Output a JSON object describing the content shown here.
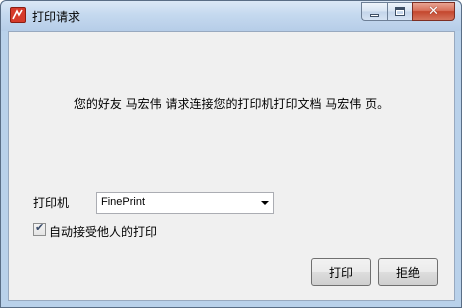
{
  "window": {
    "title": "打印请求",
    "icon": "print-app-icon",
    "controls": {
      "minimize": "minimize-icon",
      "maximize": "maximize-icon",
      "close": "close-icon"
    }
  },
  "message": "您的好友 马宏伟 请求连接您的打印机打印文档 马宏伟 页。",
  "printer": {
    "label": "打印机",
    "selected": "FinePrint"
  },
  "auto_accept": {
    "label": "自动接受他人的打印",
    "checked": true
  },
  "buttons": {
    "print": "打印",
    "reject": "拒绝"
  }
}
